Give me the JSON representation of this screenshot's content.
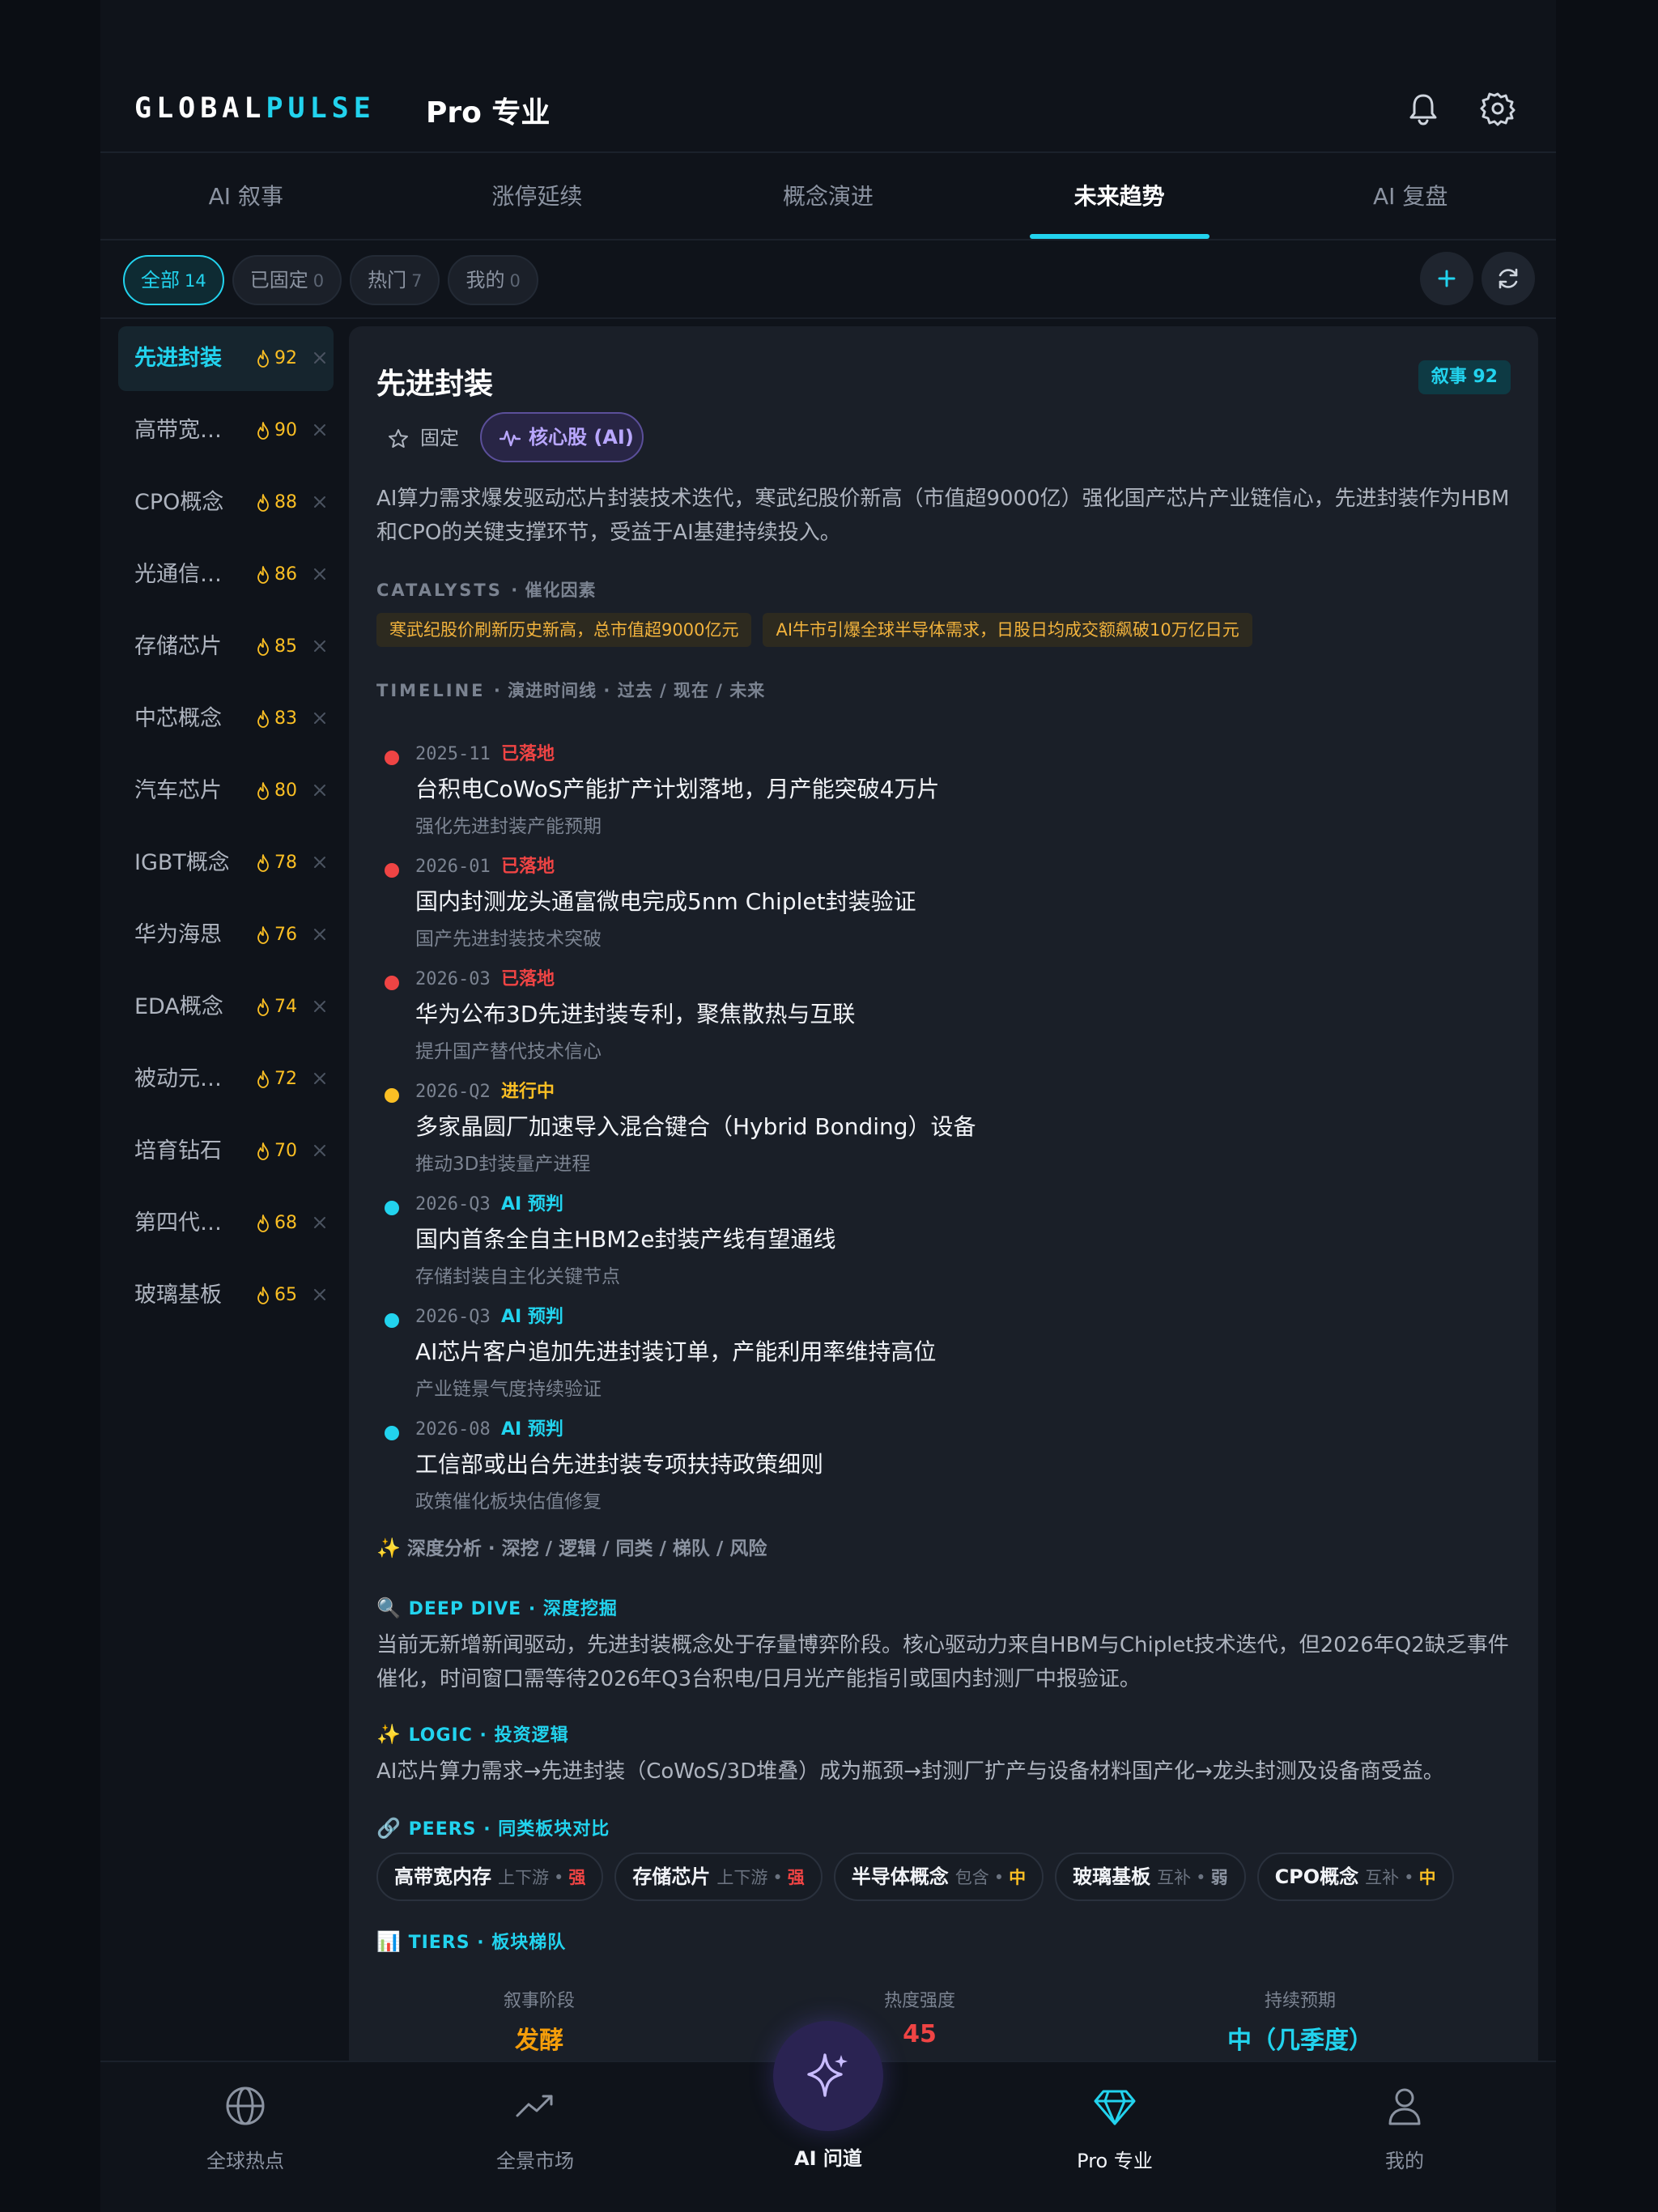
{
  "app": {
    "logo_a": "GLOBAL",
    "logo_b": "PULSE",
    "title": "Pro 专业"
  },
  "tabs": [
    {
      "label": "AI 叙事"
    },
    {
      "label": "涨停延续"
    },
    {
      "label": "概念演进"
    },
    {
      "label": "未来趋势",
      "active": true
    },
    {
      "label": "AI 复盘"
    }
  ],
  "filters": [
    {
      "label": "全部",
      "count": "14",
      "active": true
    },
    {
      "label": "已固定",
      "count": "0"
    },
    {
      "label": "热门",
      "count": "7"
    },
    {
      "label": "我的",
      "count": "0"
    }
  ],
  "sidebar": {
    "items": [
      {
        "name": "先进封装",
        "score": "92",
        "active": true
      },
      {
        "name": "高带宽…",
        "score": "90"
      },
      {
        "name": "CPO概念",
        "score": "88"
      },
      {
        "name": "光通信…",
        "score": "86"
      },
      {
        "name": "存储芯片",
        "score": "85"
      },
      {
        "name": "中芯概念",
        "score": "83"
      },
      {
        "name": "汽车芯片",
        "score": "80"
      },
      {
        "name": "IGBT概念",
        "score": "78"
      },
      {
        "name": "华为海思",
        "score": "76"
      },
      {
        "name": "EDA概念",
        "score": "74"
      },
      {
        "name": "被动元…",
        "score": "72"
      },
      {
        "name": "培育钻石",
        "score": "70"
      },
      {
        "name": "第四代…",
        "score": "68"
      },
      {
        "name": "玻璃基板",
        "score": "65"
      }
    ]
  },
  "detail": {
    "title": "先进封装",
    "badge": "叙事 92",
    "pin_label": "固定",
    "core_label": "核心股 (AI)",
    "summary": "AI算力需求爆发驱动芯片封装技术迭代，寒武纪股价新高（市值超9000亿）强化国产芯片产业链信心，先进封装作为HBM和CPO的关键支撑环节，受益于AI基建持续投入。",
    "catalysts_label": "CATALYSTS",
    "catalysts_sub": "· 催化因素",
    "catalysts": [
      "寒武纪股价刷新历史新高，总市值超9000亿元",
      "AI牛市引爆全球半导体需求，日股日均成交额飙破10万亿日元"
    ],
    "timeline_label": "TIMELINE",
    "timeline_sub": "· 演进时间线 · 过去 / 现在 / 未来",
    "timeline": [
      {
        "date": "2025-11",
        "status": "已落地",
        "color": "#ef4444",
        "title": "台积电CoWoS产能扩产计划落地，月产能突破4万片",
        "sub": "强化先进封装产能预期"
      },
      {
        "date": "2026-01",
        "status": "已落地",
        "color": "#ef4444",
        "title": "国内封测龙头通富微电完成5nm Chiplet封装验证",
        "sub": "国产先进封装技术突破"
      },
      {
        "date": "2026-03",
        "status": "已落地",
        "color": "#ef4444",
        "title": "华为公布3D先进封装专利，聚焦散热与互联",
        "sub": "提升国产替代技术信心"
      },
      {
        "date": "2026-Q2",
        "status": "进行中",
        "color": "#fbbf24",
        "title": "多家晶圆厂加速导入混合键合（Hybrid Bonding）设备",
        "sub": "推动3D封装量产进程"
      },
      {
        "date": "2026-Q3",
        "status": "AI 预判",
        "color": "#22d3ee",
        "title": "国内首条全自主HBM2e封装产线有望通线",
        "sub": "存储封装自主化关键节点"
      },
      {
        "date": "2026-Q3",
        "status": "AI 预判",
        "color": "#22d3ee",
        "title": "AI芯片客户追加先进封装订单，产能利用率维持高位",
        "sub": "产业链景气度持续验证"
      },
      {
        "date": "2026-08",
        "status": "AI 预判",
        "color": "#22d3ee",
        "title": "工信部或出台先进封装专项扶持政策细则",
        "sub": "政策催化板块估值修复"
      }
    ],
    "analysis_head": "深度分析 · 深挖 / 逻辑 / 同类 / 梯队 / 风险",
    "deep_dive_label": "DEEP DIVE · 深度挖掘",
    "deep_dive": "当前无新增新闻驱动，先进封装概念处于存量博弈阶段。核心驱动力来自HBM与Chiplet技术迭代，但2026年Q2缺乏事件催化，时间窗口需等待2026年Q3台积电/日月光产能指引或国内封测厂中报验证。",
    "logic_label": "LOGIC · 投资逻辑",
    "logic": "AI芯片算力需求→先进封装（CoWoS/3D堆叠）成为瓶颈→封测厂扩产与设备材料国产化→龙头封测及设备商受益。",
    "peers_label": "PEERS · 同类板块对比",
    "peers": [
      {
        "name": "高带宽内存",
        "rel": "上下游",
        "strength": "强",
        "color": "#ef4444"
      },
      {
        "name": "存储芯片",
        "rel": "上下游",
        "strength": "强",
        "color": "#ef4444"
      },
      {
        "name": "半导体概念",
        "rel": "包含",
        "strength": "中",
        "color": "#fbbf24"
      },
      {
        "name": "玻璃基板",
        "rel": "互补",
        "strength": "弱",
        "color": "#8b93a1"
      },
      {
        "name": "CPO概念",
        "rel": "互补",
        "strength": "中",
        "color": "#fbbf24"
      }
    ],
    "tiers_label": "TIERS · 板块梯队",
    "tiers": [
      {
        "label": "叙事阶段",
        "value": "发酵",
        "color": "#f59e0b"
      },
      {
        "label": "热度强度",
        "value": "45",
        "color": "#ef4444"
      },
      {
        "label": "持续预期",
        "value": "中（几季度）",
        "color": "#22d3ee"
      }
    ]
  },
  "bottom_nav": [
    {
      "label": "全球热点",
      "icon": "globe-icon"
    },
    {
      "label": "全景市场",
      "icon": "trend-icon"
    },
    {
      "label": "AI 问道",
      "icon": "sparkle-icon"
    },
    {
      "label": "Pro 专业",
      "icon": "diamond-icon",
      "active": true
    },
    {
      "label": "我的",
      "icon": "user-icon"
    }
  ],
  "colors": {
    "accent": "#22d3ee",
    "background": "#0f131a",
    "card": "#1a1f28",
    "hot": "#fbbf24",
    "done": "#ef4444",
    "ai": "#b9a7ff"
  }
}
